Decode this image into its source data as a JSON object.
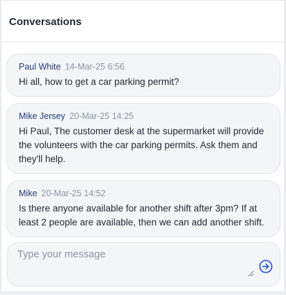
{
  "header": {
    "title": "Conversations"
  },
  "messages": [
    {
      "author": "Paul White",
      "time": "14-Mar-25 6:56",
      "text": "Hi all, how to get a car parking permit?"
    },
    {
      "author": "Mike Jersey",
      "time": "20-Mar-25 14:25",
      "text": "Hi Paul, The customer desk at the supermarket will provide the volunteers with the car parking permits. Ask them and they'll help."
    },
    {
      "author": "Mike",
      "time": "20-Mar-25 14:52",
      "text": "Is there anyone available for another shift after 3pm? If at least 2 people are available, then we can add another shift."
    }
  ],
  "composer": {
    "placeholder": "Type your message",
    "value": "",
    "send_icon": "arrow-right-circle-icon"
  },
  "colors": {
    "author": "#243a7a",
    "accent": "#2f5fd6",
    "bubble_background": "#f4f5f7"
  }
}
